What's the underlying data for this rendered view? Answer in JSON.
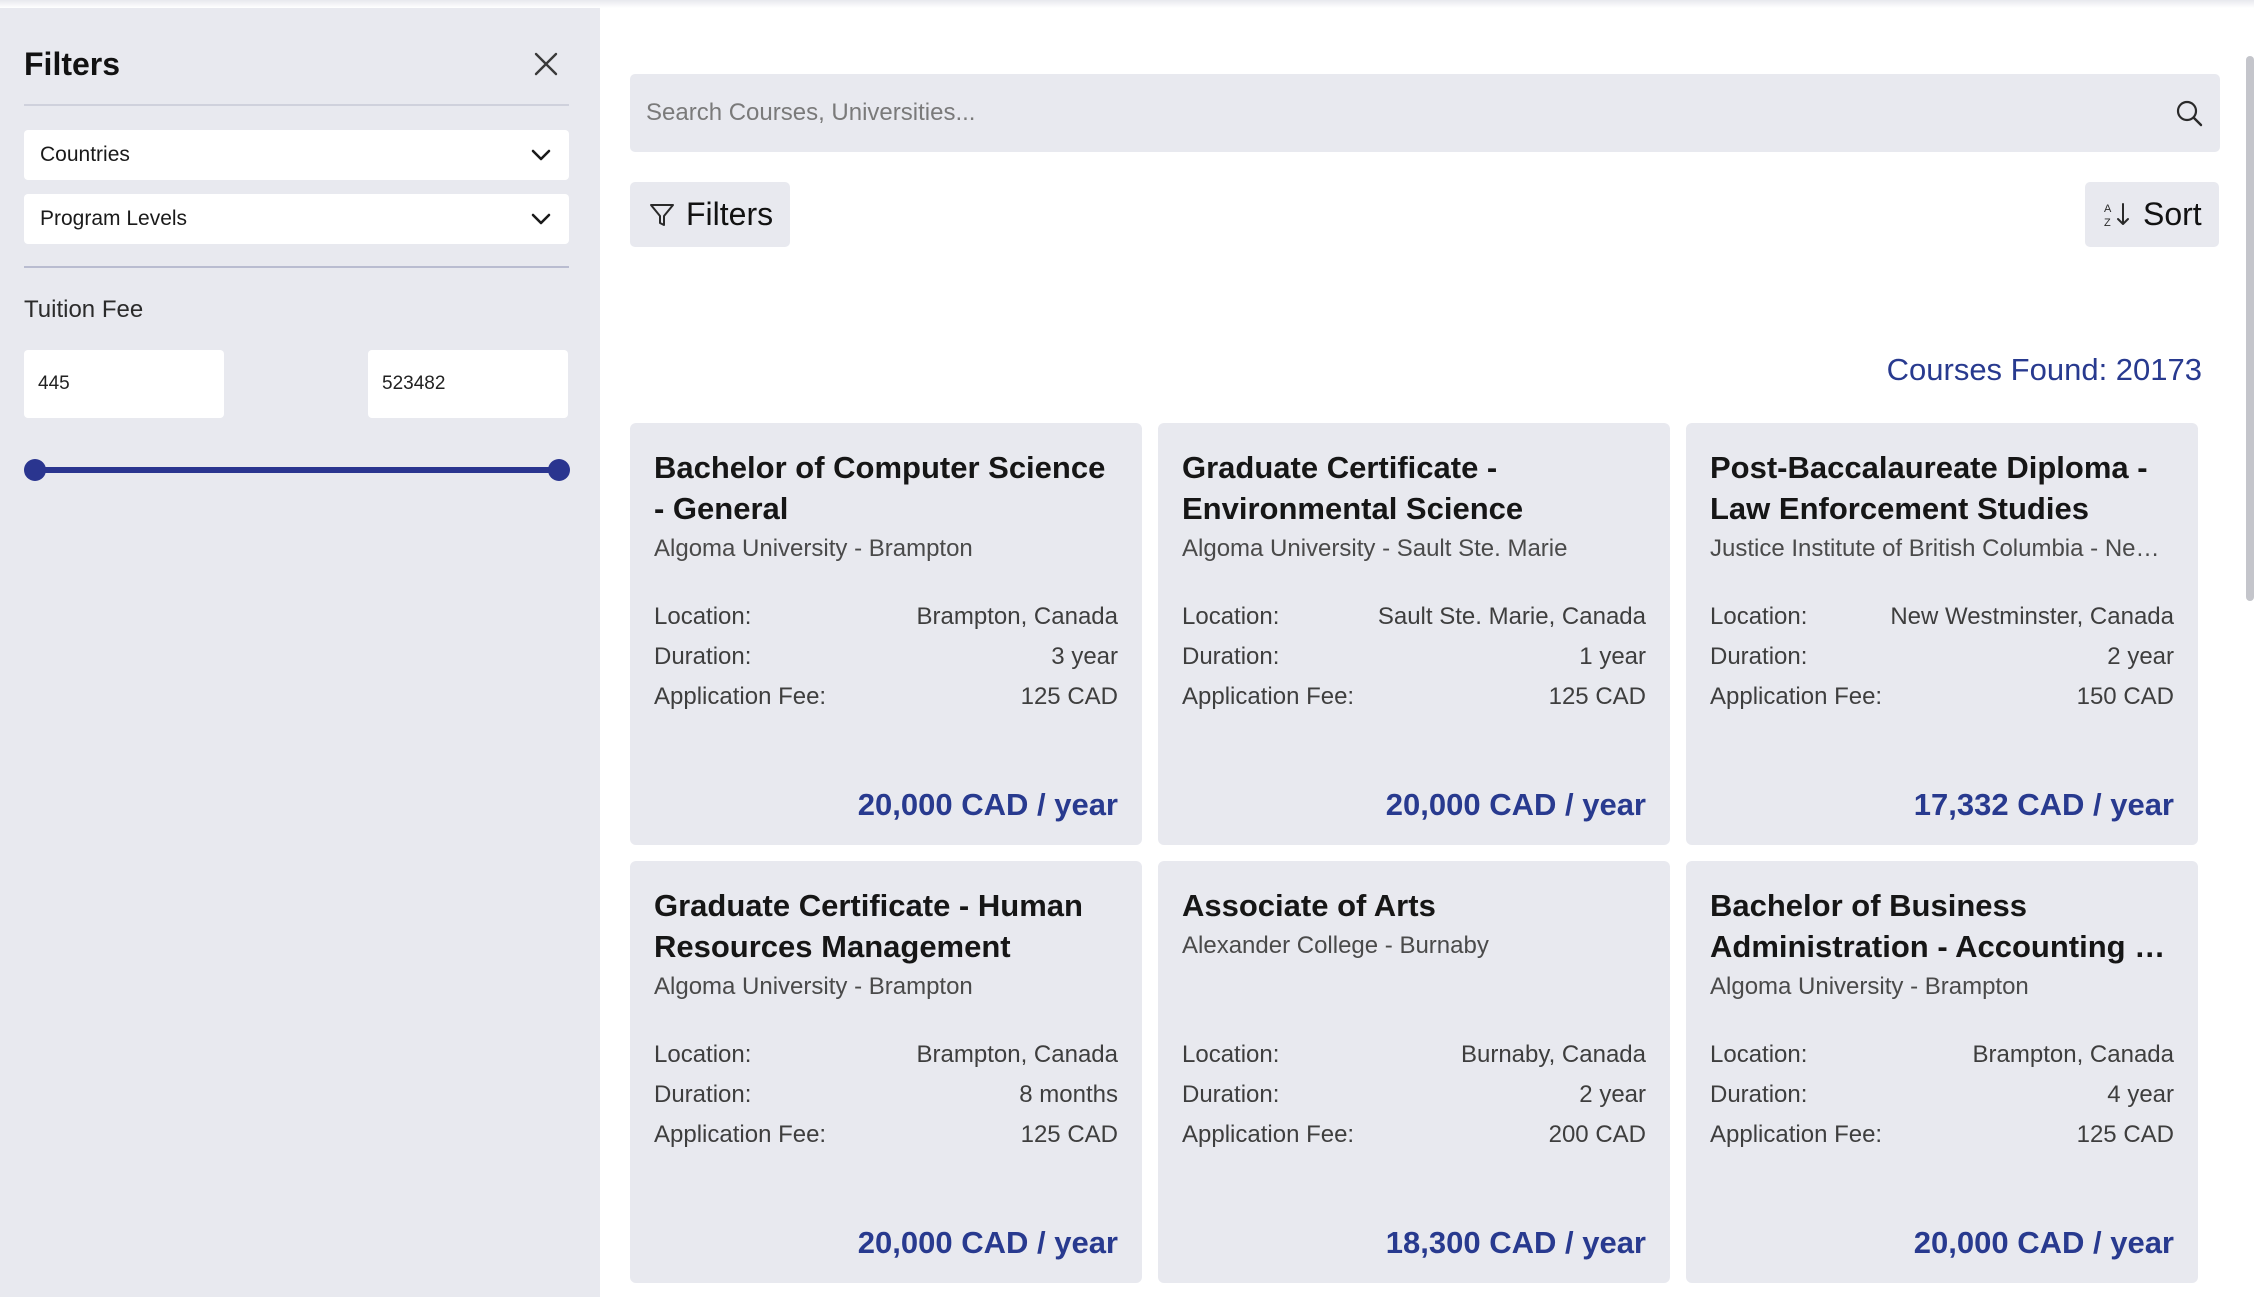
{
  "sidebar": {
    "title": "Filters",
    "close_icon": "close-icon",
    "countries_label": "Countries",
    "program_levels_label": "Program Levels",
    "tuition_fee_label": "Tuition Fee",
    "fee_min": "445",
    "fee_max": "523482",
    "slider_range_fraction": [
      0,
      1
    ]
  },
  "search": {
    "placeholder": "Search Courses, Universities...",
    "icon": "search-icon"
  },
  "toolbar": {
    "filters_label": "Filters",
    "filters_icon": "funnel-icon",
    "sort_label": "Sort",
    "sort_icon": "sort-az-icon"
  },
  "results": {
    "courses_found": "Courses Found: 20173"
  },
  "labels": {
    "location": "Location:",
    "duration": "Duration:",
    "application_fee": "Application Fee:"
  },
  "courses": [
    {
      "title": "Bachelor of Computer Science - General",
      "university": "Algoma University - Brampton",
      "location": "Brampton, Canada",
      "duration": "3 year",
      "application_fee": "125 CAD",
      "tuition": "20,000 CAD / year"
    },
    {
      "title": "Graduate Certificate - Environmental Science",
      "university": "Algoma University - Sault Ste. Marie",
      "location": "Sault Ste. Marie, Canada",
      "duration": "1 year",
      "application_fee": "125 CAD",
      "tuition": "20,000 CAD / year"
    },
    {
      "title": "Post-Baccalaureate Diploma - Law Enforcement Studies",
      "university": "Justice Institute of British Columbia - New Westminster",
      "location": "New Westminster, Canada",
      "duration": "2 year",
      "application_fee": "150 CAD",
      "tuition": "17,332 CAD / year"
    },
    {
      "title": "Graduate Certificate - Human Resources Management",
      "university": "Algoma University - Brampton",
      "location": "Brampton, Canada",
      "duration": "8 months",
      "application_fee": "125 CAD",
      "tuition": "20,000 CAD / year"
    },
    {
      "title": "Associate of Arts",
      "university": "Alexander College - Burnaby",
      "location": "Burnaby, Canada",
      "duration": "2 year",
      "application_fee": "200 CAD",
      "tuition": "18,300 CAD / year"
    },
    {
      "title": "Bachelor of Business Administration - Accounting - Brampton",
      "university": "Algoma University - Brampton",
      "location": "Brampton, Canada",
      "duration": "4 year",
      "application_fee": "125 CAD",
      "tuition": "20,000 CAD / year"
    }
  ],
  "colors": {
    "accent": "#283a8f",
    "panel": "#e8e9ef"
  }
}
